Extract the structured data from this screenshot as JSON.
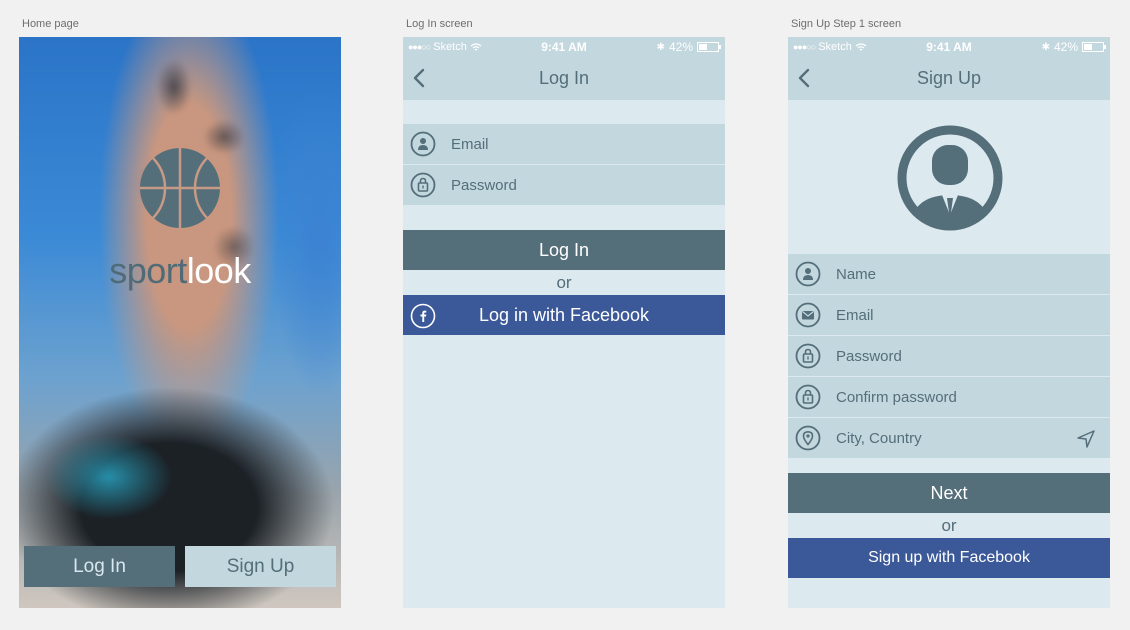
{
  "artboards": {
    "home": "Home page",
    "login": "Log In screen",
    "signup": "Sign Up Step 1 screen"
  },
  "status_bar": {
    "carrier": "Sketch",
    "time": "9:41 AM",
    "battery": "42%"
  },
  "home": {
    "logo_part1": "sport",
    "logo_part2": "look",
    "login_label": "Log In",
    "signup_label": "Sign Up"
  },
  "login": {
    "title": "Log In",
    "email_placeholder": "Email",
    "password_placeholder": "Password",
    "login_button": "Log In",
    "or": "or",
    "facebook_button": "Log in with Facebook"
  },
  "signup": {
    "title": "Sign Up",
    "name_placeholder": "Name",
    "email_placeholder": "Email",
    "password_placeholder": "Password",
    "confirm_placeholder": "Confirm password",
    "city_placeholder": "City, Country",
    "next_button": "Next",
    "or": "or",
    "facebook_button": "Sign up with Facebook"
  },
  "colors": {
    "primary": "#546e7a",
    "field_bg": "#c3d7de",
    "screen_bg": "#dce9ef",
    "facebook": "#3b5998"
  }
}
